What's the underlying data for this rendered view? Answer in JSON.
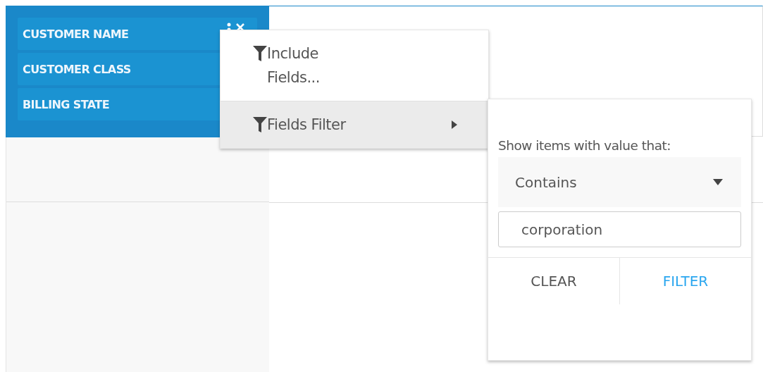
{
  "fields": [
    {
      "label": "CUSTOMER NAME",
      "kind": "active"
    },
    {
      "label": "CUSTOMER CLASS",
      "kind": "plain"
    },
    {
      "label": "BILLING STATE",
      "kind": "plain"
    }
  ],
  "menu": {
    "items": [
      {
        "label": "Include Fields...",
        "submenu": false,
        "selected": false
      },
      {
        "label": "Fields Filter",
        "submenu": true,
        "selected": true
      }
    ]
  },
  "filter": {
    "prompt": "Show items with value that:",
    "condition": "Contains",
    "value": "corporation",
    "buttons": [
      {
        "label": "CLEAR",
        "kind": "secondary"
      },
      {
        "label": "FILTER",
        "kind": "primary"
      }
    ]
  }
}
